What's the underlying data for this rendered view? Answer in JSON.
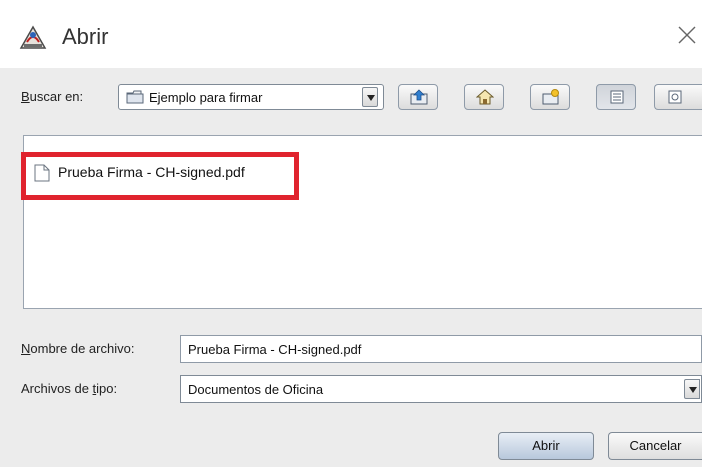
{
  "window": {
    "title": "Abrir"
  },
  "icons": {
    "app": "java-coffee-icon",
    "close": "close-icon",
    "folder": "folder-icon",
    "up": "up-folder-icon",
    "home": "home-icon",
    "new_folder": "new-folder-icon",
    "list": "list-view-icon",
    "details": "details-view-icon",
    "file": "document-icon"
  },
  "lookin": {
    "label": "Buscar en:",
    "value": "Ejemplo para firmar"
  },
  "files": [
    {
      "name": "Prueba Firma - CH-signed.pdf"
    }
  ],
  "filename": {
    "label": "Nombre de archivo:",
    "value": "Prueba Firma - CH-signed.pdf"
  },
  "filetype": {
    "label": "Archivos de tipo:",
    "value": "Documentos de Oficina"
  },
  "buttons": {
    "open": "Abrir",
    "cancel": "Cancelar"
  },
  "colors": {
    "highlight": "#e0232e",
    "dialog_bg": "#ececec"
  }
}
